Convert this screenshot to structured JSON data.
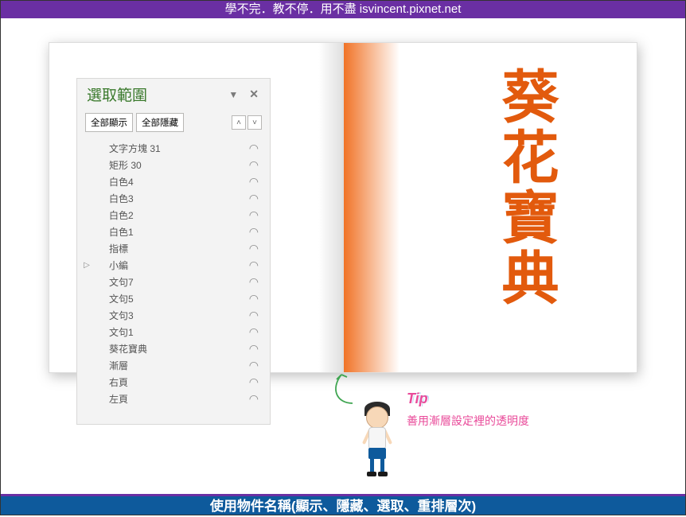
{
  "header": {
    "text": "學不完．教不停．用不盡 isvincent.pixnet.net"
  },
  "footer": {
    "text": "使用物件名稱(顯示、隱藏、選取、重排層次)"
  },
  "book": {
    "title": "葵花寶典"
  },
  "selection_pane": {
    "title": "選取範圍",
    "show_all": "全部顯示",
    "hide_all": "全部隱藏",
    "items": [
      {
        "name": "文字方塊 31",
        "expandable": false
      },
      {
        "name": "矩形 30",
        "expandable": false
      },
      {
        "name": "白色4",
        "expandable": false
      },
      {
        "name": "白色3",
        "expandable": false
      },
      {
        "name": "白色2",
        "expandable": false
      },
      {
        "name": "白色1",
        "expandable": false
      },
      {
        "name": "指標",
        "expandable": false
      },
      {
        "name": "小編",
        "expandable": true
      },
      {
        "name": "文句7",
        "expandable": false
      },
      {
        "name": "文句5",
        "expandable": false
      },
      {
        "name": "文句3",
        "expandable": false
      },
      {
        "name": "文句1",
        "expandable": false
      },
      {
        "name": "葵花寶典",
        "expandable": false
      },
      {
        "name": "漸層",
        "expandable": false
      },
      {
        "name": "右頁",
        "expandable": false
      },
      {
        "name": "左頁",
        "expandable": false
      }
    ]
  },
  "tip": {
    "label": "Tip",
    "text": "善用漸層設定裡的透明度"
  },
  "colors": {
    "purple": "#6a2fa3",
    "blue": "#0e5a9c",
    "orange": "#e25a0d",
    "green": "#3b7a2d",
    "pink": "#e94b9a",
    "arrow": "#3fa551"
  }
}
